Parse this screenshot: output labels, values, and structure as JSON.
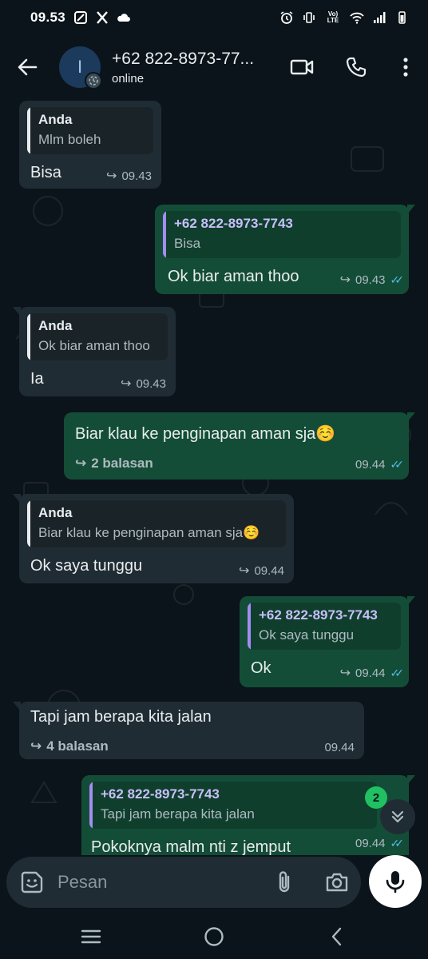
{
  "status_bar": {
    "time": "09.53",
    "network_label": "Vo) LTE"
  },
  "header": {
    "contact_name": "+62 822-8973-77...",
    "contact_status": "online",
    "avatar_letter": "I"
  },
  "messages": [
    {
      "direction": "in",
      "quote_author": "Anda",
      "quote_text": "Mlm boleh",
      "text": "Bisa",
      "time": "09.43"
    },
    {
      "direction": "out",
      "quote_author": "+62 822-8973-7743",
      "quote_text": "Bisa",
      "text": "Ok biar aman thoo",
      "time": "09.43"
    },
    {
      "direction": "in",
      "quote_author": "Anda",
      "quote_text": "Ok biar aman thoo",
      "text": "Ia",
      "time": "09.43"
    },
    {
      "direction": "out",
      "text": "Biar klau ke penginapan aman sja☺️",
      "replies": "2 balasan",
      "time": "09.44"
    },
    {
      "direction": "in",
      "quote_author": "Anda",
      "quote_text": "Biar klau ke penginapan aman sja☺️",
      "text": "Ok saya tunggu",
      "time": "09.44"
    },
    {
      "direction": "out",
      "quote_author": "+62 822-8973-7743",
      "quote_text": "Ok saya tunggu",
      "text": "Ok",
      "time": "09.44"
    },
    {
      "direction": "in",
      "text": "Tapi jam berapa kita jalan",
      "replies": "4 balasan",
      "time": "09.44"
    },
    {
      "direction": "out",
      "quote_author": "+62 822-8973-7743",
      "quote_text": "Tapi jam berapa kita jalan",
      "text": "Pokoknya malm nti z jemput",
      "time": "09.44"
    }
  ],
  "unread_count": "2",
  "composer": {
    "placeholder": "Pesan"
  },
  "colors": {
    "background": "#0b141a",
    "incoming_bubble": "#202c33",
    "outgoing_bubble": "#144d37",
    "read_ticks": "#53bdeb",
    "unread_badge": "#21c063"
  }
}
